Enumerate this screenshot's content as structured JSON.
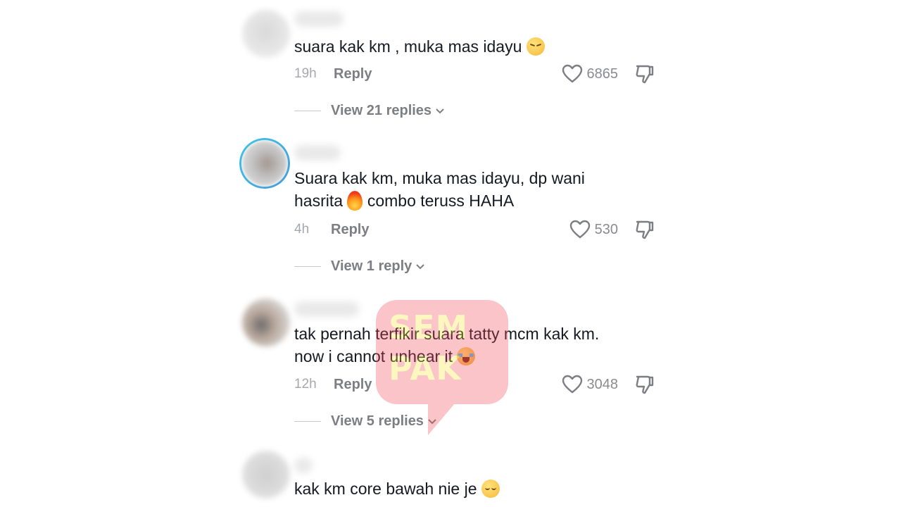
{
  "comments": [
    {
      "text_parts": [
        "suara kak km , muka mas idayu "
      ],
      "emoji": "pensive-face-icon",
      "time": "19h",
      "reply_label": "Reply",
      "likes": "6865",
      "view_replies": "View 21 replies",
      "has_story_ring": false
    },
    {
      "line1": "Suara kak km, muka mas idayu, dp wani",
      "line2_before": "hasrita ",
      "line2_after": " combo teruss HAHA",
      "emoji": "fire-icon",
      "time": "4h",
      "reply_label": "Reply",
      "likes": "530",
      "view_replies": "View 1 reply",
      "has_story_ring": true
    },
    {
      "line1": "tak pernah terfikir suara tatty mcm kak km.",
      "line2_before": "now i cannot unhear it ",
      "emoji": "loudly-crying-face-icon",
      "time": "12h",
      "reply_label": "Reply",
      "likes": "3048",
      "view_replies": "View 5 replies",
      "has_story_ring": false
    },
    {
      "line1_before": "kak km core bawah nie je ",
      "emoji": "relieved-face-icon",
      "has_story_ring": false
    }
  ],
  "watermark": {
    "line1": "SEM",
    "line2": "PAK",
    "color_box": "#f04a5a",
    "color_text": "#f7e43a"
  },
  "colors": {
    "text": "#161823",
    "muted": "#7d7e84",
    "time": "#a7a8ad",
    "story_ring": "#1ac4e8"
  }
}
